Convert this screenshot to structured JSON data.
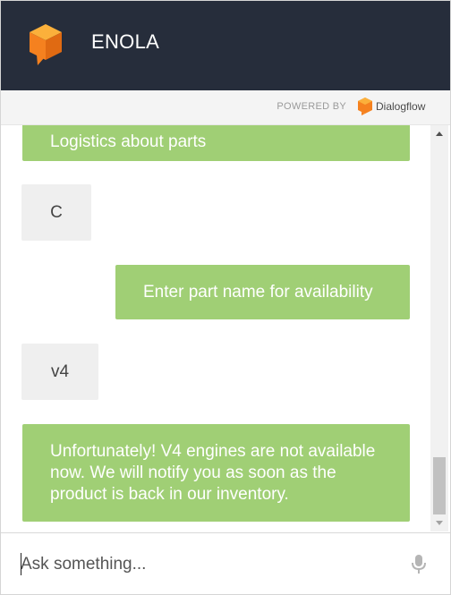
{
  "header": {
    "bot_name": "ENOLA",
    "logo_icon": "cube-chat-icon"
  },
  "powered_by": {
    "label": "POWERED BY",
    "brand": "Dialogflow",
    "brand_icon": "dialogflow-icon"
  },
  "messages": [
    {
      "from": "bot",
      "text": "Logistics about parts"
    },
    {
      "from": "user",
      "text": "C"
    },
    {
      "from": "bot",
      "text": "Enter part name for availability"
    },
    {
      "from": "user",
      "text": "v4"
    },
    {
      "from": "bot",
      "text": "Unfortunately! V4 engines are not available now. We will notify you as soon as the product is back in our inventory."
    }
  ],
  "input": {
    "placeholder": "Ask something...",
    "value": ""
  },
  "colors": {
    "header_bg": "#262d3b",
    "bot_bubble": "#a0cf75",
    "user_bubble": "#efefef",
    "accent_orange": "#f5811f"
  }
}
